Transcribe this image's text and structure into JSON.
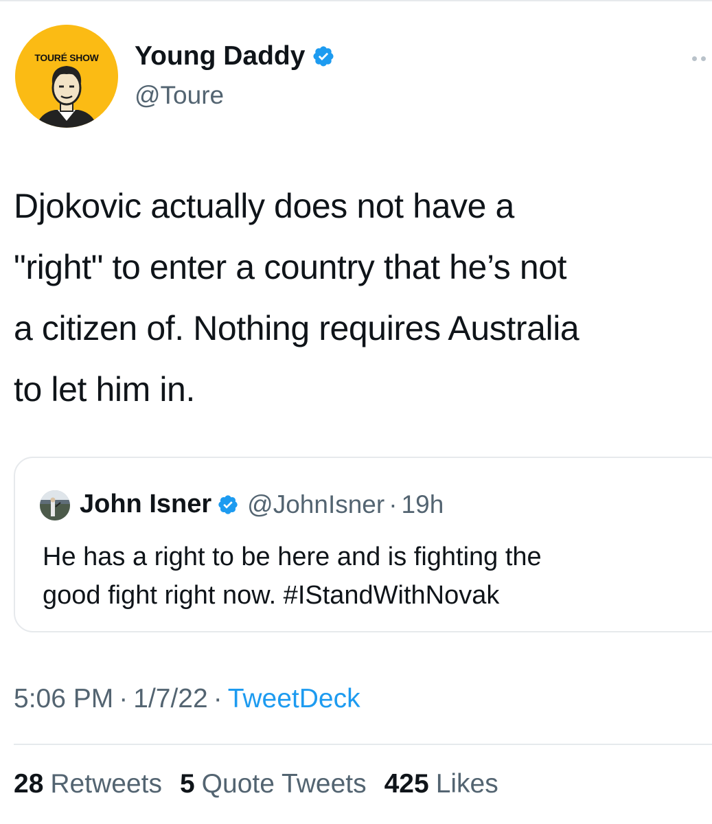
{
  "colors": {
    "accent": "#1d9bf0",
    "text_primary": "#0f1419",
    "text_secondary": "#536471",
    "avatar_bg": "#fbbb14",
    "border": "#e6e9ec"
  },
  "author": {
    "avatar_label": "TOURÉ SHOW",
    "display_name": "Young Daddy",
    "verified_icon": "verified-badge-icon",
    "handle": "@Toure"
  },
  "more_icon": "more-options-icon",
  "tweet": {
    "text_lines": [
      "Djokovic actually does not have a",
      "\"right\" to enter a country that he’s not",
      "a citizen of. Nothing requires Australia",
      "to let him in."
    ]
  },
  "quoted_tweet": {
    "display_name": "John Isner",
    "verified_icon": "verified-badge-icon",
    "handle": "@JohnIsner",
    "separator": "·",
    "time": "19h",
    "text_lines": [
      "He has a right to be here and is fighting the",
      "good fight right now. #IStandWithNovak"
    ]
  },
  "meta": {
    "time": "5:06 PM",
    "separator": "·",
    "date": "1/7/22",
    "source": "TweetDeck"
  },
  "stats": [
    {
      "count": "28",
      "label": "Retweets"
    },
    {
      "count": "5",
      "label": "Quote Tweets"
    },
    {
      "count": "425",
      "label": "Likes"
    }
  ]
}
